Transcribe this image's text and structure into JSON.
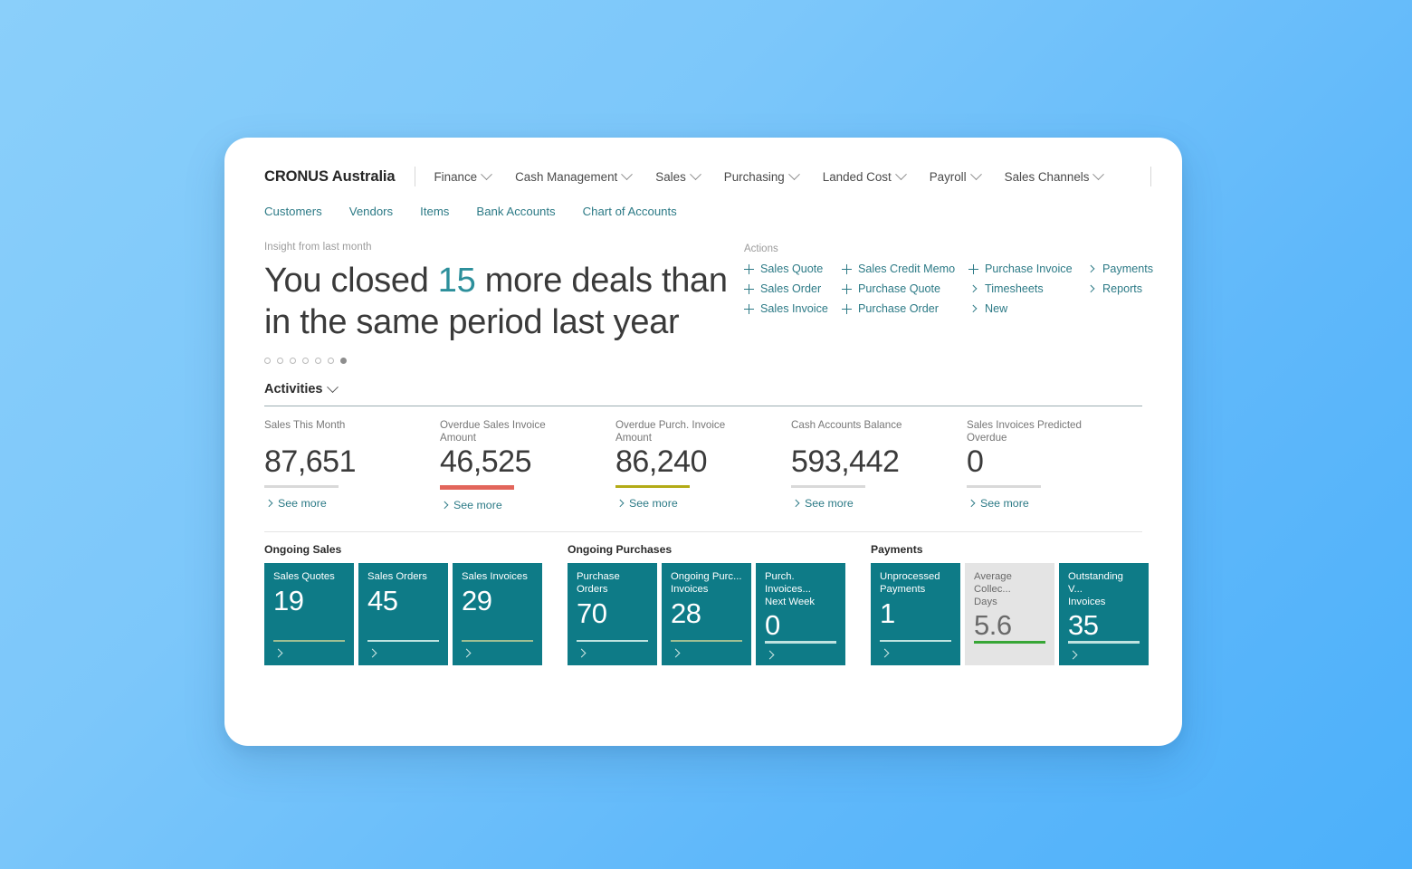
{
  "topnav": {
    "brand": "CRONUS Australia",
    "items": [
      {
        "label": "Finance",
        "caret": "chevron-down-icon"
      },
      {
        "label": "Cash Management",
        "caret": "chevron-down-icon"
      },
      {
        "label": "Sales",
        "caret": "chevron-down-icon"
      },
      {
        "label": "Purchasing",
        "caret": "chevron-down-icon"
      },
      {
        "label": "Landed Cost",
        "caret": "chevron-down-icon"
      },
      {
        "label": "Payroll",
        "caret": "chevron-down-icon"
      },
      {
        "label": "Sales Channels",
        "caret": "chevron-down-icon"
      }
    ],
    "menu_icon": "hamburger-menu-icon"
  },
  "subnav": {
    "items": [
      {
        "label": "Customers"
      },
      {
        "label": "Vendors"
      },
      {
        "label": "Items"
      },
      {
        "label": "Bank Accounts"
      },
      {
        "label": "Chart of Accounts"
      }
    ]
  },
  "hero": {
    "kicker": "Insight from last month",
    "text_before": "You closed ",
    "highlight": "15",
    "text_after": " more deals than in the same period last year",
    "highlight_color": "#2c8f9b",
    "dots_total": 7,
    "dots_active_index": 6
  },
  "actions": {
    "title": "Actions",
    "columns": [
      [
        {
          "label": "Sales Quote",
          "icon": "plus-icon"
        },
        {
          "label": "Sales Order",
          "icon": "plus-icon"
        },
        {
          "label": "Sales Invoice",
          "icon": "plus-icon"
        }
      ],
      [
        {
          "label": "Sales Credit Memo",
          "icon": "plus-icon"
        },
        {
          "label": "Purchase Quote",
          "icon": "plus-icon"
        },
        {
          "label": "Purchase Order",
          "icon": "plus-icon"
        }
      ],
      [
        {
          "label": "Purchase Invoice",
          "icon": "plus-icon"
        },
        {
          "label": "Timesheets",
          "icon": "chevron-right-icon"
        },
        {
          "label": "New",
          "icon": "chevron-right-icon"
        }
      ],
      [
        {
          "label": "Payments",
          "icon": "chevron-right-icon"
        },
        {
          "label": "Reports",
          "icon": "chevron-right-icon"
        }
      ]
    ]
  },
  "activities": {
    "title": "Activities",
    "see_more_label": "See more",
    "cues": [
      {
        "label": "Sales This Month",
        "value": "87,651",
        "bar_color": "#d9d9d9",
        "bar_thick": false
      },
      {
        "label": "Overdue Sales Invoice\nAmount",
        "value": "46,525",
        "bar_color": "#e2655b",
        "bar_thick": true
      },
      {
        "label": "Overdue Purch. Invoice\nAmount",
        "value": "86,240",
        "bar_color": "#b3ab16",
        "bar_thick": false
      },
      {
        "label": "Cash Accounts Balance",
        "value": "593,442",
        "bar_color": "#d9d9d9",
        "bar_thick": false
      },
      {
        "label": "Sales Invoices Predicted\nOverdue",
        "value": "0",
        "bar_color": "#d9d9d9",
        "bar_thick": false
      }
    ]
  },
  "groups": [
    {
      "title": "Ongoing Sales",
      "tiles": [
        {
          "label": "Sales Quotes",
          "value": "19",
          "bar_color": "#9fbf93",
          "muted": false
        },
        {
          "label": "Sales Orders",
          "value": "45",
          "bar_color": "#bfe3e0",
          "muted": false
        },
        {
          "label": "Sales Invoices",
          "value": "29",
          "bar_color": "#9fbf93",
          "muted": false
        }
      ]
    },
    {
      "title": "Ongoing Purchases",
      "tiles": [
        {
          "label": "Purchase Orders",
          "value": "70",
          "bar_color": "#bfe3e0",
          "muted": false
        },
        {
          "label": "Ongoing Purc...\nInvoices",
          "value": "28",
          "bar_color": "#9fbf93",
          "muted": false
        },
        {
          "label": "Purch. Invoices...\nNext Week",
          "value": "0",
          "bar_color": "#bfe3e0",
          "muted": false
        }
      ]
    },
    {
      "title": "Payments",
      "tiles": [
        {
          "label": "Unprocessed\nPayments",
          "value": "1",
          "bar_color": "#bfe3e0",
          "muted": false
        },
        {
          "label": "Average Collec...\nDays",
          "value": "5.6",
          "bar_color": "#37a636",
          "muted": true
        },
        {
          "label": "Outstanding V...\nInvoices",
          "value": "35",
          "bar_color": "#bfe3e0",
          "muted": false
        }
      ]
    }
  ],
  "theme": {
    "tile_teal": "#0e7b87",
    "link_teal": "#2c7a86",
    "muted_tile": "#e4e4e4"
  }
}
